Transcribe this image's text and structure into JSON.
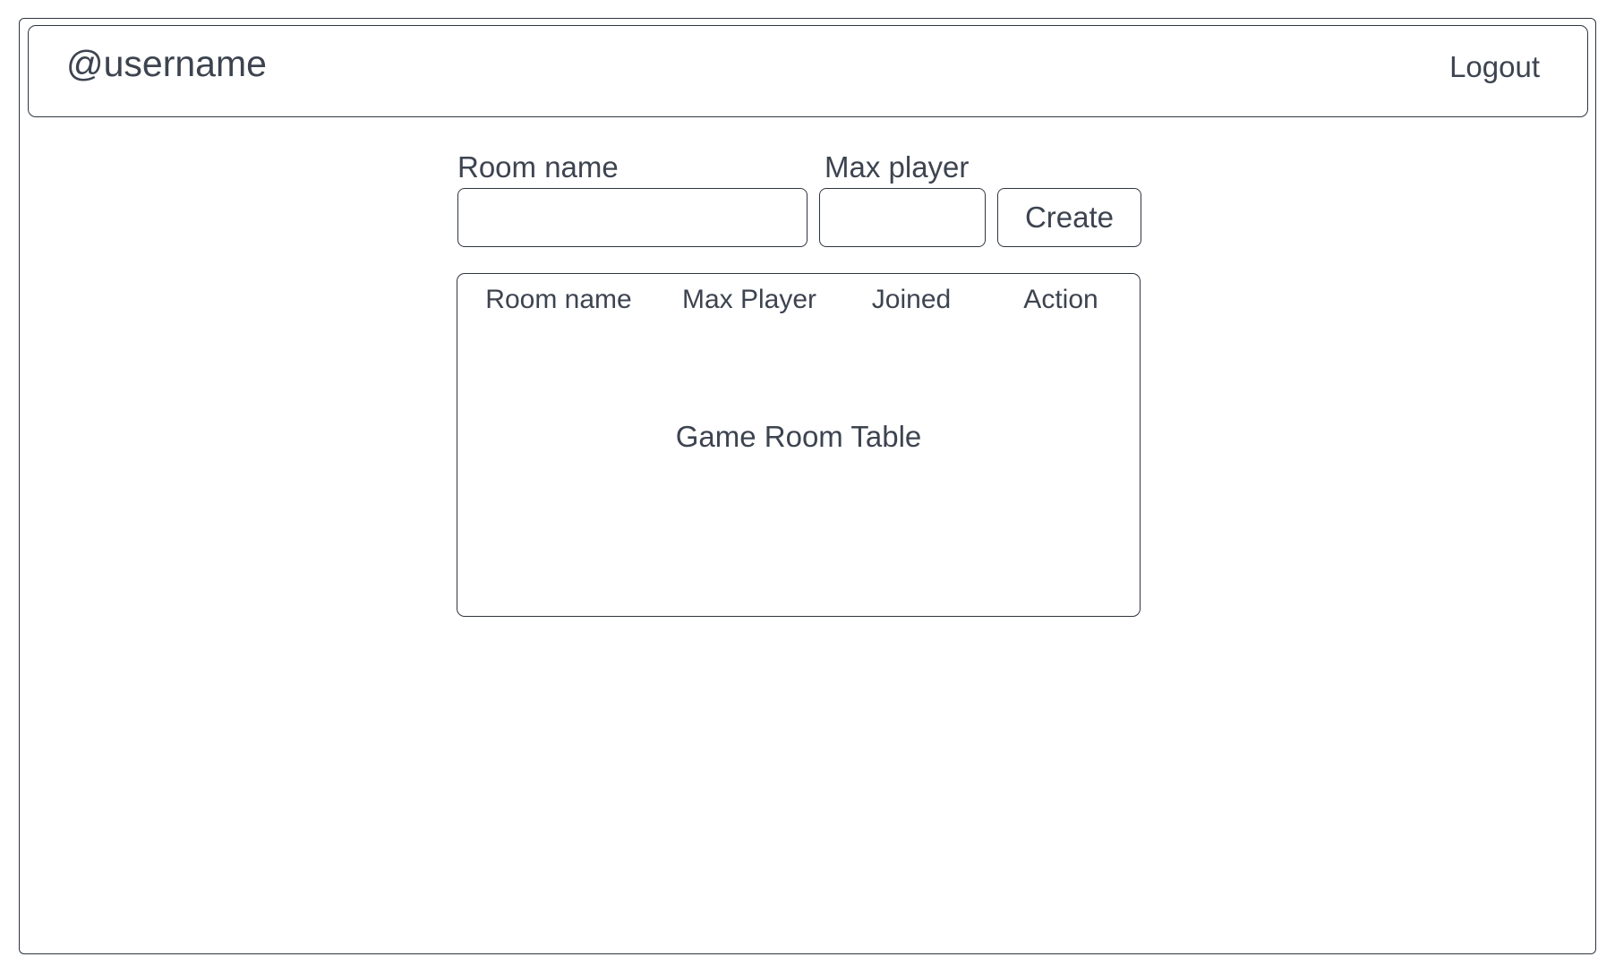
{
  "header": {
    "username": "@username",
    "logout_label": "Logout"
  },
  "create_form": {
    "room_name_label": "Room name",
    "room_name_value": "",
    "max_player_label": "Max player",
    "max_player_value": "",
    "create_label": "Create"
  },
  "room_table": {
    "columns": [
      "Room name",
      "Max Player",
      "Joined",
      "Action"
    ],
    "placeholder": "Game Room Table",
    "rows": []
  }
}
